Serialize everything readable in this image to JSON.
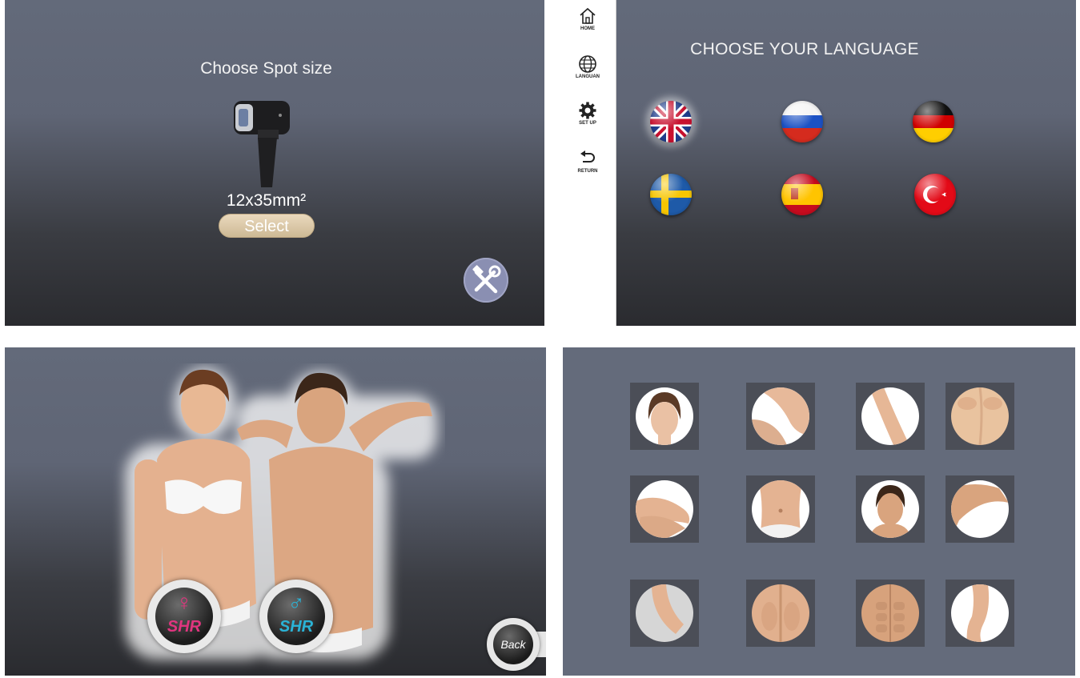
{
  "spot_screen": {
    "title": "Choose Spot size",
    "spot_size": "12x35mm²",
    "select_label": "Select"
  },
  "language_screen": {
    "sidebar": {
      "items": [
        {
          "label": "HOME",
          "icon": "home-icon"
        },
        {
          "label": "LANGUAN",
          "icon": "globe-icon"
        },
        {
          "label": "SET UP",
          "icon": "gear-icon"
        },
        {
          "label": "RETURN",
          "icon": "return-icon"
        }
      ]
    },
    "title": "CHOOSE YOUR LANGUAGE",
    "flags": [
      {
        "country": "uk",
        "selected": true
      },
      {
        "country": "russia",
        "selected": false
      },
      {
        "country": "germany",
        "selected": false
      },
      {
        "country": "sweden",
        "selected": false
      },
      {
        "country": "spain",
        "selected": false
      },
      {
        "country": "turkey",
        "selected": false
      }
    ]
  },
  "gender_screen": {
    "female_label": "SHR",
    "male_label": "SHR",
    "female_color": "#e0357f",
    "male_color": "#2ab3d6",
    "back_label": "Back"
  },
  "body_area_screen": {
    "areas": [
      "face",
      "underarm",
      "arm",
      "back",
      "hand",
      "abdomen",
      "male-face",
      "upper-arm",
      "elbow",
      "lower-back",
      "chest",
      "leg"
    ]
  }
}
